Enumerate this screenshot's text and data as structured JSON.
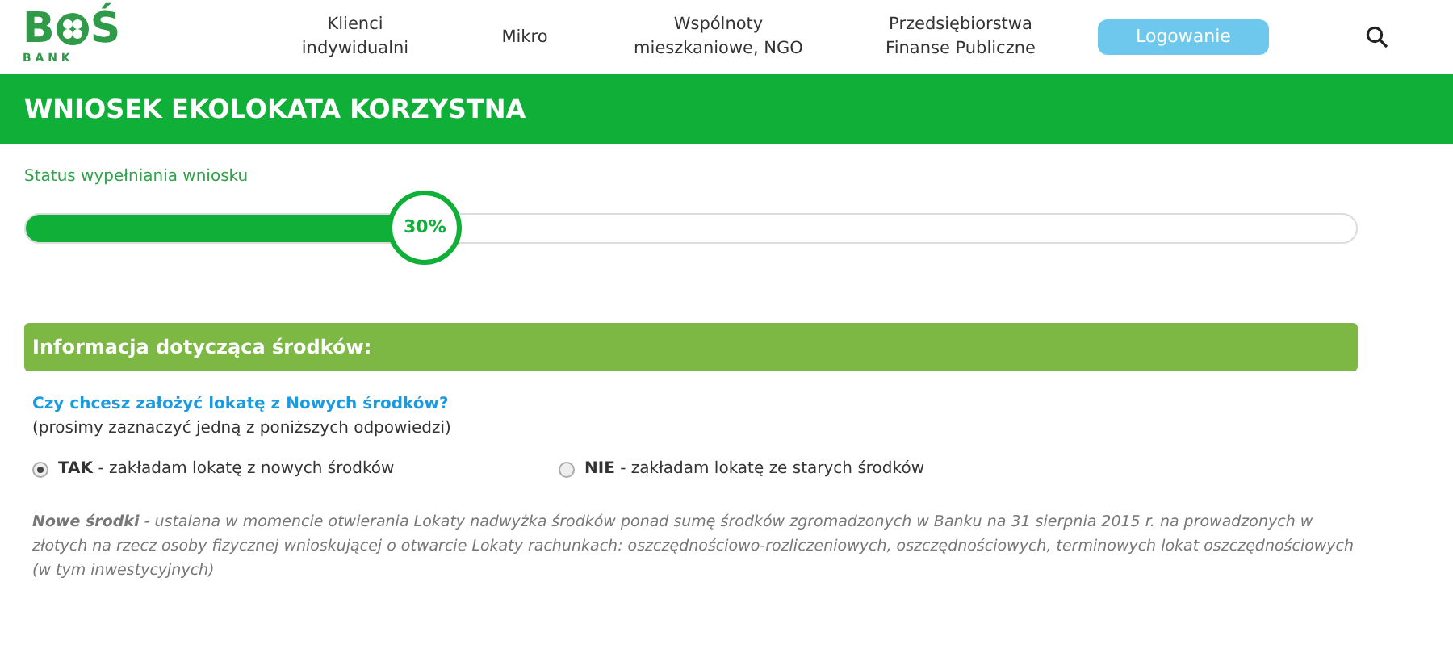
{
  "logo": {
    "left": "B",
    "right": "Ś",
    "sub": "B A N K"
  },
  "nav": [
    {
      "label": "Klienci\nindywidualni"
    },
    {
      "label": "Mikro"
    },
    {
      "label": "Wspólnoty\nmieszkaniowe, NGO"
    },
    {
      "label": "Przedsiębiorstwa\nFinanse Publiczne"
    }
  ],
  "login_button": "Logowanie",
  "page_title": "WNIOSEK EKOLOKATA KORZYSTNA",
  "progress": {
    "label": "Status wypełniania wniosku",
    "level": 0.3,
    "reading": "30%"
  },
  "section": {
    "title": "Informacja dotycząca środków:",
    "question": "Czy chcesz założyć lokatę z Nowych środków?",
    "hint": "(prosimy zaznaczyć jedną z poniższych odpowiedzi)",
    "options": [
      {
        "label": "**TAK** - zakładam lokatę z nowych środków",
        "selected": true
      },
      {
        "label": "**NIE** - zakładam lokatę ze starych środków",
        "selected": false
      }
    ],
    "note": "**Nowe środki** - ustalana w momencie otwierania Lokaty nadwyżka środków ponad sumę środków zgromadzonych w Banku na 31 sierpnia 2015 r. na prowadzonych w złotych na rzecz osoby fizycznej wnioskującej o otwarcie Lokaty rachunkach: oszczędnościowo-rozliczeniowych, oszczędnościowych, terminowych lokat oszczędnościowych (w tym inwestycyjnych)"
  }
}
